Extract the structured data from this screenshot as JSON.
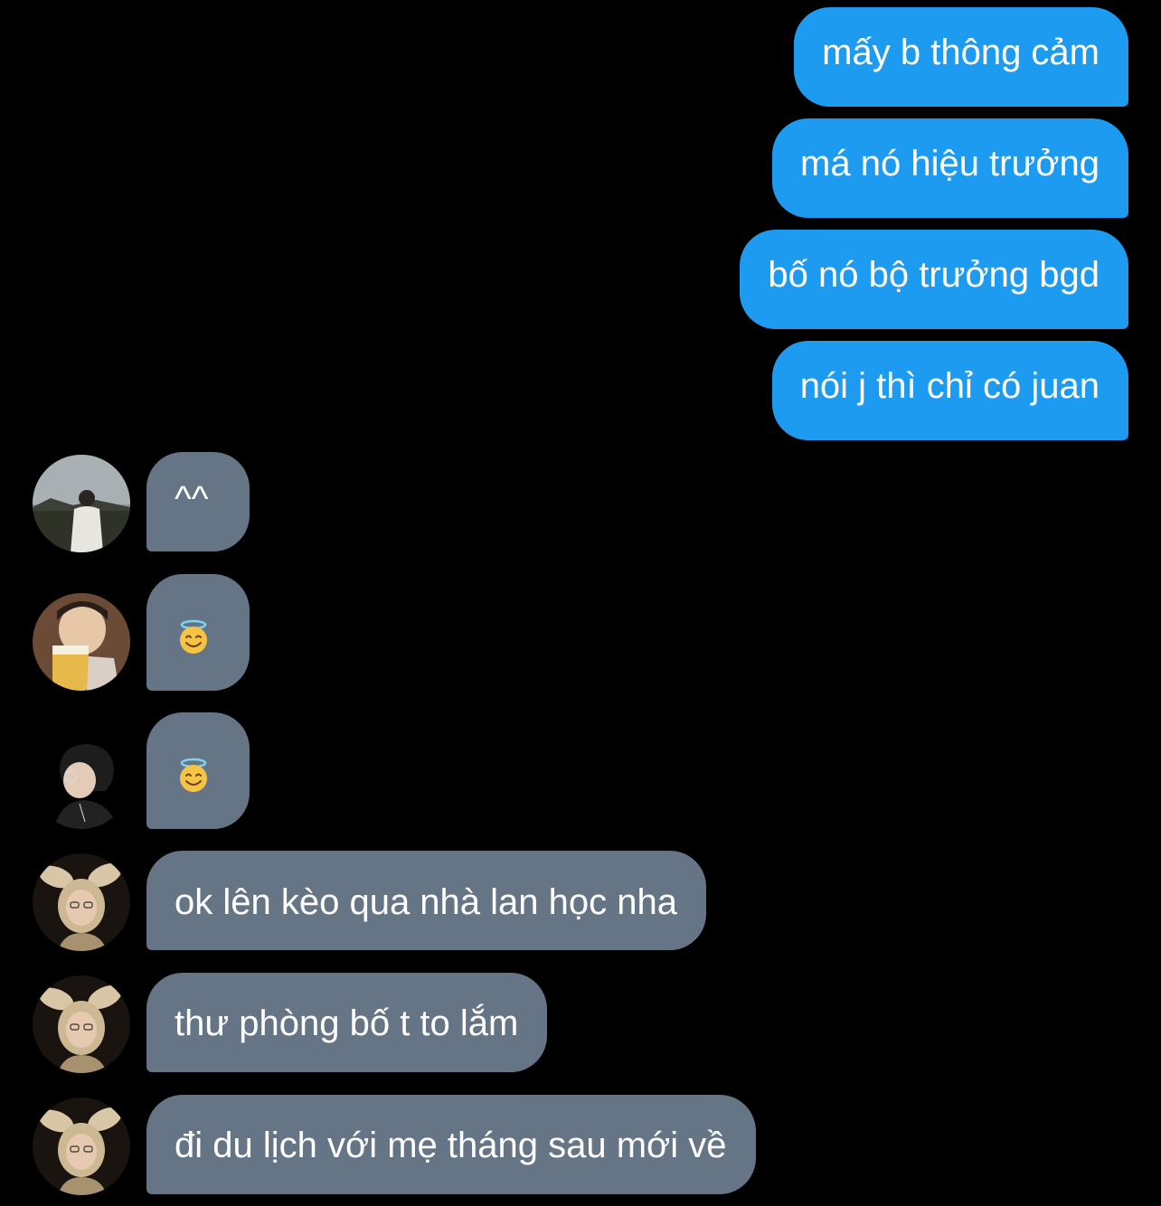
{
  "conversation": {
    "outgoing": [
      {
        "text": "mấy b thông cảm"
      },
      {
        "text": "má nó hiệu trưởng"
      },
      {
        "text": "bố nó bộ trưởng bgd"
      },
      {
        "text": "nói j thì chỉ có juan"
      }
    ],
    "incoming": [
      {
        "text": "^^",
        "avatar": "avatar-outdoor-photo"
      },
      {
        "text": "",
        "emoji": "smiling-face-with-halo",
        "avatar": "avatar-beer-photo"
      },
      {
        "text": "",
        "emoji": "smiling-face-with-halo",
        "avatar": "avatar-glasses-profile"
      },
      {
        "text": "ok lên kèo qua nhà lan học nha",
        "avatar": "avatar-bunny-ears"
      },
      {
        "text": "thư phòng bố t to lắm",
        "avatar": "avatar-bunny-ears"
      },
      {
        "text": "đi du lịch với mẹ tháng sau mới về",
        "avatar": "avatar-bunny-ears"
      }
    ]
  },
  "colors": {
    "background": "#000000",
    "outgoing_bubble": "#1d9bf0",
    "incoming_bubble": "#657585",
    "text": "#ffffff"
  }
}
